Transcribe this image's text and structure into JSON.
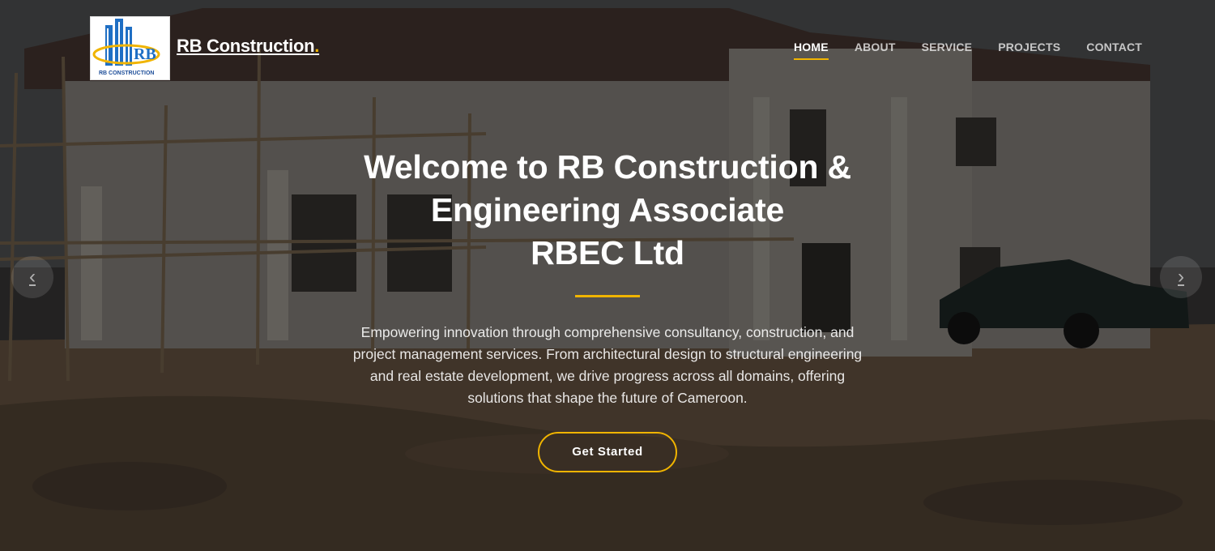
{
  "header": {
    "brand_name": "RB Construction",
    "brand_dot": ".",
    "logo_text": "RB CONSTRUCTION",
    "logo_monogram": "RB"
  },
  "nav": {
    "items": [
      {
        "label": "HOME",
        "active": true
      },
      {
        "label": "ABOUT",
        "active": false
      },
      {
        "label": "SERVICE",
        "active": false
      },
      {
        "label": "PROJECTS",
        "active": false
      },
      {
        "label": "CONTACT",
        "active": false
      }
    ]
  },
  "hero": {
    "title_line1": "Welcome to RB Construction &",
    "title_line2": "Engineering Associate",
    "title_line3": "RBEC Ltd",
    "description": "Empowering innovation through comprehensive consultancy, construction, and project management services. From architectural design to structural engineering and real estate development, we drive progress across all domains, offering solutions that shape the future of Cameroon.",
    "cta_label": "Get Started"
  },
  "carousel": {
    "prev_icon": "chevron-left-icon",
    "next_icon": "chevron-right-icon",
    "prev_glyph": "‹",
    "next_glyph": "›"
  },
  "colors": {
    "accent": "#f0b400",
    "logo_blue": "#1f6fc4",
    "overlay": "rgba(0,0,0,0.42)"
  }
}
